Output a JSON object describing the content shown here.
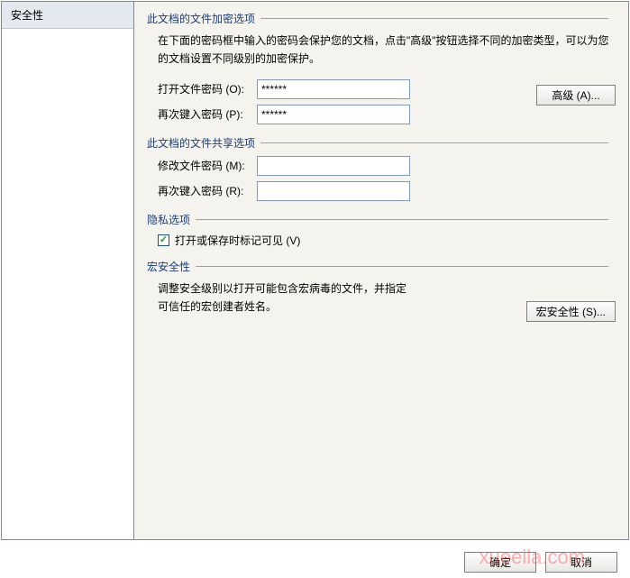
{
  "sidebar": {
    "items": [
      {
        "label": "安全性"
      }
    ]
  },
  "groups": {
    "encrypt": {
      "title": "此文档的文件加密选项",
      "desc": "在下面的密码框中输入的密码会保护您的文档，点击\"高级\"按钮选择不同的加密类型，可以为您的文档设置不同级别的加密保护。",
      "open_pw_label": "打开文件密码 (O):",
      "open_pw_value": "******",
      "retype_label": "再次键入密码 (P):",
      "retype_value": "******",
      "advanced_label": "高级 (A)..."
    },
    "share": {
      "title": "此文档的文件共享选项",
      "modify_pw_label": "修改文件密码 (M):",
      "modify_pw_value": "",
      "retype_label": "再次键入密码 (R):",
      "retype_value": ""
    },
    "privacy": {
      "title": "隐私选项",
      "checkbox_label": "打开或保存时标记可见 (V)"
    },
    "macro": {
      "title": "宏安全性",
      "desc": "调整安全级别以打开可能包含宏病毒的文件，并指定可信任的宏创建者姓名。",
      "button_label": "宏安全性 (S)..."
    }
  },
  "footer": {
    "ok": "确定",
    "cancel": "取消"
  },
  "watermark": "xueeila.com"
}
